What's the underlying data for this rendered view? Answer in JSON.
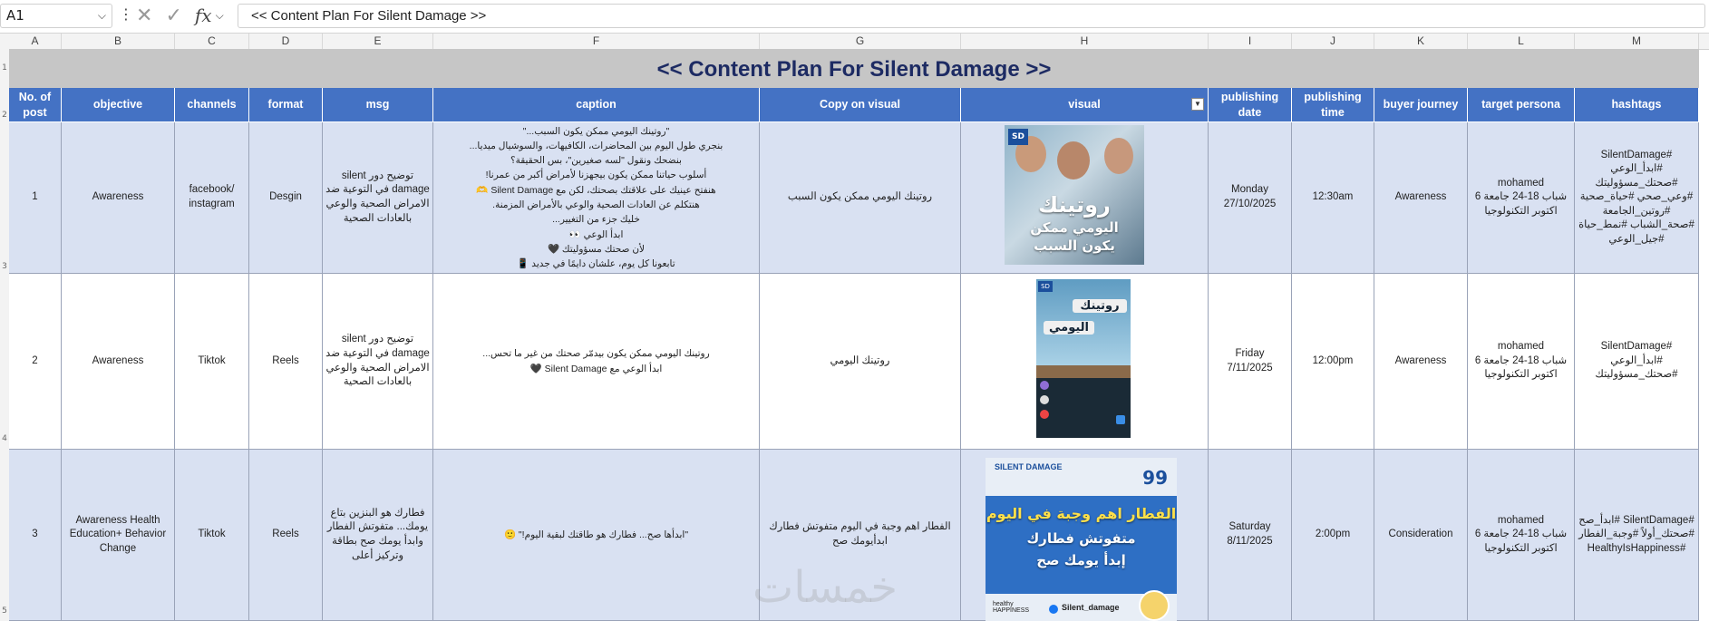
{
  "formula_bar": {
    "name_box": "A1",
    "formula": "<< Content Plan For Silent Damage >>"
  },
  "columns": [
    "A",
    "B",
    "C",
    "D",
    "E",
    "F",
    "G",
    "H",
    "I",
    "J",
    "K",
    "L",
    "M"
  ],
  "row_numbers": [
    "1",
    "2",
    "3",
    "4",
    "5"
  ],
  "sheet_title": "<< Content Plan For Silent Damage >>",
  "headers": {
    "no": "No. of post",
    "objective": "objective",
    "channels": "channels",
    "format": "format",
    "msg": "msg",
    "caption": "caption",
    "copy": "Copy on visual",
    "visual": "visual",
    "date": "publishing date",
    "time": "publishing time",
    "journey": "buyer journey",
    "persona": "target persona",
    "hashtags": "hashtags"
  },
  "rows": [
    {
      "no": "1",
      "objective": "Awareness",
      "channels": "facebook/ instagram",
      "format": "Desgin",
      "msg": "توضيح دور silent damage في التوعية ضد الامراض الصحية والوعي بالعادات الصحية",
      "caption": [
        "\"روتينك اليومي ممكن يكون السبب...\"",
        "بنجري طول اليوم بين المحاضرات، الكافيهات، والسوشيال ميديا...",
        "بنضحك ونقول \"لسه صغيرين\"، بس الحقيقة؟",
        "أسلوب حياتنا ممكن يكون بيجهزنا لأمراض أكبر من عمرنا!",
        "هنفتح عينيك على علاقتك بصحتك، لكن مع Silent Damage 🫶",
        "هنتكلم عن العادات الصحية والوعي بالأمراض المزمنة.",
        "خليك جزء من التغيير...",
        "ابدأ الوعي 👀",
        "لأن صحتك مسؤوليتك 🖤",
        "تابعونا كل يوم، علشان دايمًا في جديد 📱"
      ],
      "copy": "روتينك اليومي ممكن يكون السبب",
      "visual_text": [
        "روتينك",
        "اليومي ممكن",
        "يكون السبب"
      ],
      "date": "Monday 27/10/2025",
      "time": "12:30am",
      "journey": "Awareness",
      "persona_name": "mohamed",
      "persona_desc": "شباب 18-24 جامعة 6 اكتوبر التكنولوجيا",
      "hashtags": "#SilentDamage #ابدأ_الوعي #صحتك_مسؤوليتك #وعي_صحي #حياة_صحية #روتين_الجامعة #صحة_الشباب #نمط_حياة #جيل_الوعي"
    },
    {
      "no": "2",
      "objective": "Awareness",
      "channels": "Tiktok",
      "format": "Reels",
      "msg": "توضيح دور silent damage في التوعية ضد الامراض الصحية والوعي بالعادات الصحية",
      "caption": [
        "روتينك اليومي ممكن يكون بيدمّر صحتك من غير ما تحس...",
        "ابدأ الوعي مع Silent Damage 🖤"
      ],
      "copy": "روتينك اليومي",
      "visual_text": [
        "روتينك",
        "اليومي"
      ],
      "date": "Friday 7/11/2025",
      "time": "12:00pm",
      "journey": "Awareness",
      "persona_name": "mohamed",
      "persona_desc": "شباب 18-24 جامعة 6 اكتوبر التكنولوجيا",
      "hashtags": "#SilentDamage #ابدأ_الوعي #صحتك_مسؤوليتك"
    },
    {
      "no": "3",
      "objective": "Awareness Health Education+ Behavior Change",
      "channels": "Tiktok",
      "format": "Reels",
      "msg": "فطارك هو البنزين بتاع يومك... متفوتش الفطار وابدأ يومك صح بطاقة وتركيز أعلى",
      "caption": [
        "\"ابدأها صح... فطارك هو طاقتك لبقية اليوم!\" 🙂"
      ],
      "copy": "الفطار اهم وجبة في اليوم متفوتش فطارك ابدأيومك صح",
      "visual_text": [
        "الفطار اهم وجبة في اليوم",
        "متفوتش فطارك",
        "إبدأ يومك صح"
      ],
      "visual_brand": "SILENT DAMAGE",
      "visual_handle": "Silent_damage",
      "visual_footer": "healthy HAPPINESS",
      "date": "Saturday 8/11/2025",
      "time": "2:00pm",
      "journey": "Consideration",
      "persona_name": "mohamed",
      "persona_desc": "شباب 18-24 جامعة 6 اكتوبر التكنولوجيا",
      "hashtags": "#SilentDamage #ابدأ_صح #صحتك_أولاً #وجبة_الفطار #HealthyIsHappiness"
    }
  ],
  "watermark": "خمسات",
  "colors": {
    "header_blue": "#4472c4",
    "row_shade": "#d9e1f2",
    "title_bg": "#c6c6c6",
    "title_text": "#1d2b63"
  }
}
